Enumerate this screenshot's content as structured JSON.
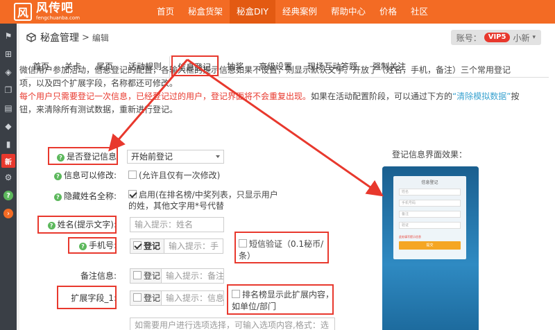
{
  "header": {
    "logo_mark": "风",
    "logo_name": "风传吧",
    "logo_sub": "fengchuanba.com",
    "nav": [
      "首页",
      "秘盒货架",
      "秘盒DIY",
      "经典案例",
      "帮助中心",
      "价格",
      "社区"
    ],
    "active_nav_index": 2
  },
  "sidebar": {
    "icons": [
      "flag-icon",
      "sitemap-icon",
      "cubes-icon",
      "clone-icon",
      "film-icon",
      "tags-icon",
      "briefcase-icon",
      "new-badge",
      "users-icon",
      "help-icon",
      "arrow-circle-icon"
    ],
    "new_label": "新",
    "help_glyph": "?",
    "arrow_glyph": "›"
  },
  "breadcrumb": {
    "title": "秘盒管理",
    "separator": ">",
    "sub": "编辑"
  },
  "user": {
    "prefix": "账号：",
    "vip": "VIP5",
    "name": "小新"
  },
  "tabs": [
    "首页",
    "关卡",
    "尾页",
    "活动规则",
    "信息登记",
    "抽奖",
    "高级设置",
    "现场互动答题",
    "强制关注"
  ],
  "active_tab_index": 4,
  "intro": {
    "line1": "微信用户参加活动，信息登记的配置，各输入框的提示信息如果不设置，则显示默认文字。开放了（姓名，手机，备注）三个常用登记项，以及四个扩展字段，名称都还可修改。",
    "red": "每个用户只需要登记一次信息，已经登记过的用户，登记界面将不会重复出现。",
    "line2_a": "如果在活动配置阶段，可以通过下方的",
    "link": "“清除模拟数据”",
    "line2_b": "按钮，来清除所有测试数据，重新进行登记。"
  },
  "form": {
    "register_label": "是否登记信息",
    "register_value": "开始前登记",
    "editable_label": "信息可以修改:",
    "editable_option": "(允许且仅有一次修改)",
    "hide_name_label": "隐藏姓名全称:",
    "hide_name_option": "启用(在排名榜/中奖列表，只显示用户的姓，其他文字用*号代替",
    "name_label": "姓名(提示文字):",
    "name_placeholder": "输入提示：姓名",
    "phone_label": "手机号:",
    "phone_addon": "登记",
    "phone_placeholder": "输入提示：手",
    "sms_option": "短信验证（0.1秘币/条）",
    "note_label": "备注信息:",
    "note_addon": "登记",
    "note_placeholder": "输入提示：备注",
    "ext1_label": "扩展字段_1:",
    "ext1_addon": "登记",
    "ext1_placeholder": "输入提示：信息",
    "ext1_option": "排名榜显示此扩展内容，如单位/部门",
    "textarea_placeholder": "如需要用户进行选项选择，可输入选项内容,格式：选"
  },
  "preview": {
    "title": "登记信息界面效果：",
    "card_title": "信息登记",
    "fields": [
      "姓名",
      "手机号码",
      "备注",
      "验证"
    ],
    "note": "此处填写提示信息",
    "button": "提交"
  },
  "colors": {
    "brand": "#f36b24",
    "alert_red": "#e8382d",
    "link_blue": "#3ba3d0",
    "help_green": "#5cb85c"
  }
}
